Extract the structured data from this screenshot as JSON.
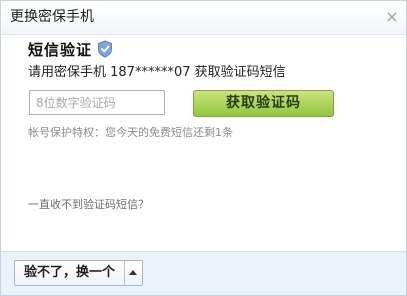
{
  "dialog": {
    "title": "更换密保手机",
    "close_icon": "close-icon"
  },
  "sms": {
    "section_title": "短信验证",
    "shield_icon": "shield-check-icon",
    "instruction": "请用密保手机 187******07 获取验证码短信",
    "input_placeholder": "8位数字验证码",
    "input_value": "",
    "get_code_label": "获取验证码",
    "privilege_note": "帐号保护特权：您今天的免费短信还剩1条",
    "no_sms_link": "一直收不到验证码短信？"
  },
  "footer": {
    "switch_label": "验不了，换一个",
    "arrow_icon": "chevron-up-icon"
  },
  "colors": {
    "accent_green": "#96c53e",
    "footer_bg": "#eaf1f9",
    "shield_blue": "#7fa6d3"
  }
}
